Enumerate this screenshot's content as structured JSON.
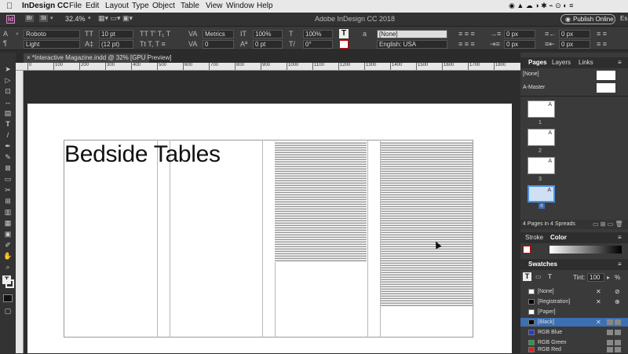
{
  "menubar": {
    "app": "InDesign CC",
    "items": [
      "File",
      "Edit",
      "Layout",
      "Type",
      "Object",
      "Table",
      "View",
      "Window",
      "Help"
    ],
    "window_title": "Adobe InDesign CC 2018"
  },
  "appbar": {
    "br": "Br",
    "st": "St",
    "zoom": "32.4%",
    "publish": "Publish Online",
    "workspace": "Es"
  },
  "control": {
    "font": "Roboto",
    "style": "Light",
    "size": "10 pt",
    "leading": "(12 pt)",
    "kerning": "Metrics",
    "tracking": "0",
    "hscale": "100%",
    "vscale": "100%",
    "baseline": "0 pt",
    "skew": "0°",
    "char_style": "[None]",
    "language": "English: USA",
    "pos1": "0 px",
    "pos2": "0 px",
    "pos3": "0 px",
    "pos4": "0 px"
  },
  "document": {
    "tab": "*Interactive Magazine.indd @ 32% [GPU Preview]",
    "headline": "Bedside Tables",
    "ruler_marks": [
      "0",
      "100",
      "200",
      "300",
      "400",
      "500",
      "600",
      "700",
      "800",
      "900",
      "1000",
      "1100",
      "1200",
      "1300",
      "1400",
      "1500",
      "1600",
      "1700",
      "1800"
    ]
  },
  "pages_panel": {
    "tabs": [
      "Pages",
      "Layers",
      "Links"
    ],
    "none": "[None]",
    "master": "A-Master",
    "page_labels": [
      "1",
      "2",
      "3",
      "4"
    ],
    "page_letters": [
      "A",
      "A",
      "A",
      "A"
    ],
    "footer": "4 Pages in 4 Spreads"
  },
  "stroke_panel": {
    "tabs": [
      "Stroke",
      "Color"
    ]
  },
  "swatches_panel": {
    "title": "Swatches",
    "tint_label": "Tint:",
    "tint_value": "100",
    "tint_unit": "%",
    "items": [
      {
        "name": "[None]",
        "color": "#ffffff"
      },
      {
        "name": "[Registration]",
        "color": "#000000"
      },
      {
        "name": "[Paper]",
        "color": "#ffffff"
      },
      {
        "name": "[Black]",
        "color": "#000000"
      },
      {
        "name": "RGB Blue",
        "color": "#1a3de0"
      },
      {
        "name": "RGB Green",
        "color": "#1fa33a"
      },
      {
        "name": "RGB Red",
        "color": "#e02020"
      }
    ]
  },
  "colors": {
    "selected_row": "#3d6fb3",
    "accent": "#4a90e2"
  }
}
